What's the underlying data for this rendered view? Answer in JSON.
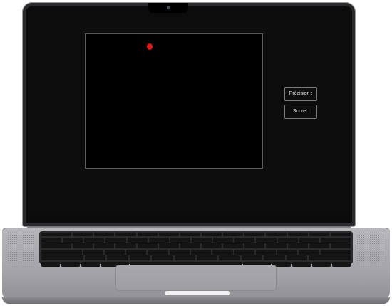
{
  "hud": {
    "precision_label": "Précision :",
    "score_label": "Score :"
  },
  "colors": {
    "screen_background": "#0d0d0d",
    "game_area_background": "#000000",
    "target": "#e01818",
    "laptop_body": "#a4a4a8"
  },
  "icons": {
    "camera": "camera-icon"
  }
}
